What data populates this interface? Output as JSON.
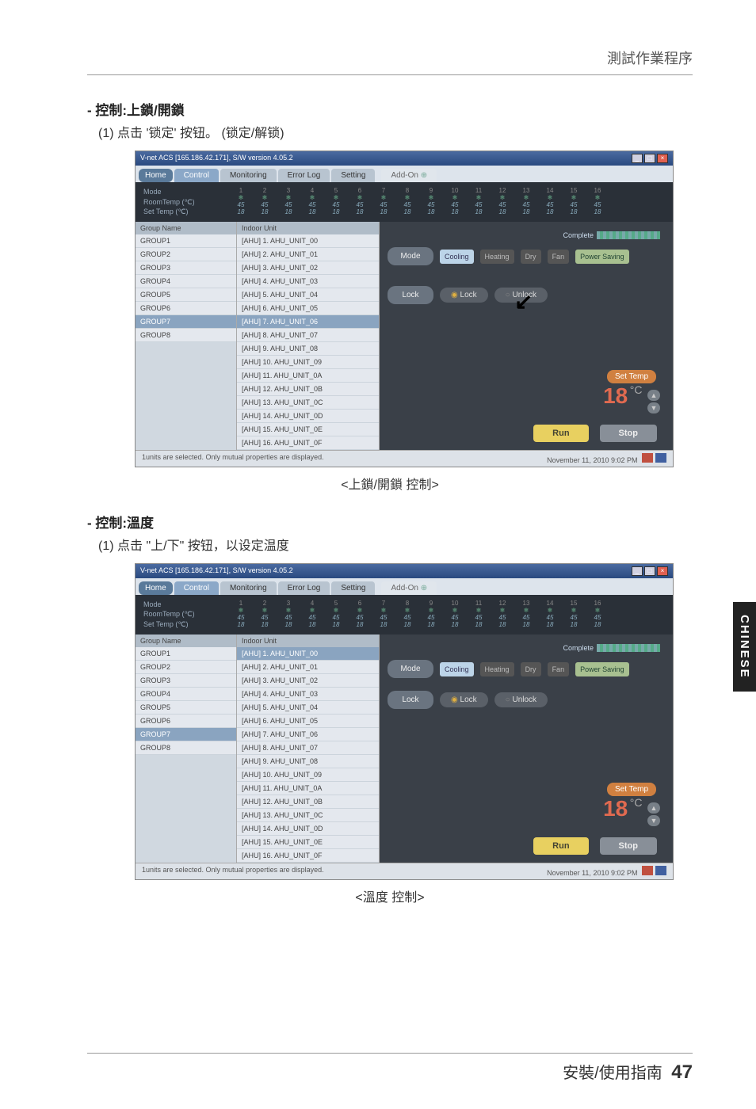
{
  "header": {
    "breadcrumb": "測試作業程序"
  },
  "side_tab": "CHINESE",
  "footer": {
    "text": "安裝/使用指南",
    "page": "47"
  },
  "sections": [
    {
      "title": "- 控制:上鎖/開鎖",
      "step": "(1) 点击 '锁定' 按钮。 (锁定/解锁)",
      "caption": "<上鎖/開鎖 控制>",
      "arrow_target": "lock"
    },
    {
      "title": "- 控制:溫度",
      "step": "(1) 点击 \"上/下\" 按钮，以设定温度",
      "caption": "<溫度 控制>",
      "arrow_target": "temp"
    }
  ],
  "app": {
    "titlebar": "V-net ACS [165.186.42.171],  S/W version 4.05.2",
    "tabs": {
      "home": "Home",
      "control": "Control",
      "monitoring": "Monitoring",
      "errorlog": "Error Log",
      "setting": "Setting",
      "addon": "Add-On"
    },
    "darkband": {
      "labels": [
        "Mode",
        "RoomTemp (℃)",
        "Set Temp  (℃)"
      ],
      "cols": 16,
      "room": "45",
      "set": "18"
    },
    "group_header": "Group Name",
    "groups": [
      "GROUP1",
      "GROUP2",
      "GROUP3",
      "GROUP4",
      "GROUP5",
      "GROUP6",
      "GROUP7",
      "GROUP8"
    ],
    "group_selected": "GROUP7",
    "unit_header": "Indoor Unit",
    "units": [
      "[AHU] 1. AHU_UNIT_00",
      "[AHU] 2. AHU_UNIT_01",
      "[AHU] 3. AHU_UNIT_02",
      "[AHU] 4. AHU_UNIT_03",
      "[AHU] 5. AHU_UNIT_04",
      "[AHU] 6. AHU_UNIT_05",
      "[AHU] 7. AHU_UNIT_06",
      "[AHU] 8. AHU_UNIT_07",
      "[AHU] 9. AHU_UNIT_08",
      "[AHU] 10. AHU_UNIT_09",
      "[AHU] 11. AHU_UNIT_0A",
      "[AHU] 12. AHU_UNIT_0B",
      "[AHU] 13. AHU_UNIT_0C",
      "[AHU] 14. AHU_UNIT_0D",
      "[AHU] 15. AHU_UNIT_0E",
      "[AHU] 16. AHU_UNIT_0F"
    ],
    "unit_selected_1": "[AHU] 7. AHU_UNIT_06",
    "unit_selected_2": "[AHU] 1. AHU_UNIT_00",
    "complete": "Complete",
    "mode_label": "Mode",
    "modes": {
      "cooling": "Cooling",
      "heating": "Heating",
      "dry": "Dry",
      "fan": "Fan",
      "power": "Power Saving"
    },
    "lock_label": "Lock",
    "lock": "Lock",
    "unlock": "Unlock",
    "settemp_label": "Set Temp",
    "settemp_value": "18",
    "settemp_unit": "°C",
    "run": "Run",
    "stop": "Stop",
    "status_left": "1units are selected. Only mutual properties are displayed.",
    "status_right": "November 11, 2010  9:02 PM"
  }
}
